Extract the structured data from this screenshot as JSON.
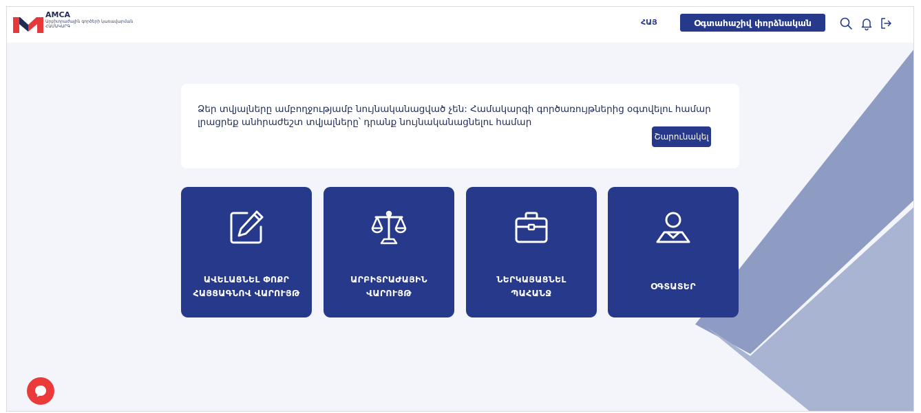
{
  "colors": {
    "primary": "#26398a",
    "accent": "#ea3a3a",
    "background": "#f3f5fa",
    "logo_red": "#e63a3a"
  },
  "header": {
    "brand_title": "AMCA",
    "brand_subtitle_line1": "Արբիտրաժային գործերի կառավարման",
    "brand_subtitle_line2": "ՀԱՄԱԿԱՐԳ",
    "language": "ՀԱՅ",
    "user_button": "Օգտահաշիվ փորձնական",
    "icons": [
      "search-icon",
      "bell-icon",
      "logout-icon"
    ]
  },
  "alert": {
    "message": "Ձեր տվյալները ամբողջությամբ նույնականացված չեն: Համակարգի գործառույթներից օգտվելու համար լրացրեք անհրաժեշտ տվյալները՝ դրանք նույնականացնելու համար",
    "button": "Շարունակել"
  },
  "tiles": [
    {
      "label_line1": "ԱՎԵԼԱՑՆԵԼ ՓՈՔՐ",
      "label_line2": "ՀԱՅՑԱԳՆՈՎ ՎԱՐՈՒՅԹ",
      "icon": "edit-icon"
    },
    {
      "label_line1": "ԱՐԲԻՏՐԱԺԱՅԻՆ",
      "label_line2": "ՎԱՐՈՒՅԹ",
      "icon": "scales-icon"
    },
    {
      "label_line1": "ՆԵՐԿԱՅԱՑՆԵԼ",
      "label_line2": "ՊԱՀԱՆՋ",
      "icon": "briefcase-icon"
    },
    {
      "label_line1": "ՕԳՏԱՏԵՐ",
      "label_line2": "",
      "icon": "user-icon"
    }
  ],
  "chat_icon": "chat-icon"
}
